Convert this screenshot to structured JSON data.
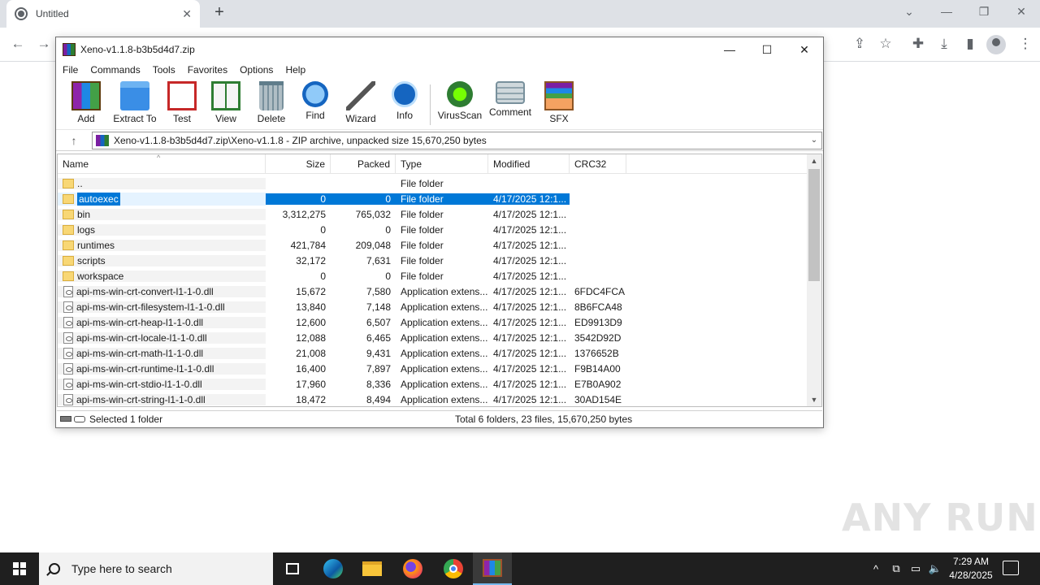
{
  "browser": {
    "tab_title": "Untitled",
    "new_tab": "+",
    "close_tab": "✕"
  },
  "winrar": {
    "title": "Xeno-v1.1.8-b3b5d4d7.zip",
    "menu": [
      "File",
      "Commands",
      "Tools",
      "Favorites",
      "Options",
      "Help"
    ],
    "toolbar": [
      {
        "label": "Add",
        "icon": "add-archive-icon"
      },
      {
        "label": "Extract To",
        "icon": "extract-folder-icon"
      },
      {
        "label": "Test",
        "icon": "test-clipboard-icon"
      },
      {
        "label": "View",
        "icon": "view-book-icon"
      },
      {
        "label": "Delete",
        "icon": "trash-icon"
      },
      {
        "label": "Find",
        "icon": "magnifier-icon"
      },
      {
        "label": "Wizard",
        "icon": "wand-icon"
      },
      {
        "label": "Info",
        "icon": "info-icon"
      },
      {
        "label": "VirusScan",
        "icon": "virus-scan-icon"
      },
      {
        "label": "Comment",
        "icon": "comment-icon"
      },
      {
        "label": "SFX",
        "icon": "sfx-box-icon"
      }
    ],
    "path": "Xeno-v1.1.8-b3b5d4d7.zip\\Xeno-v1.1.8 - ZIP archive, unpacked size 15,670,250 bytes",
    "columns": {
      "name": "Name",
      "size": "Size",
      "packed": "Packed",
      "type": "Type",
      "modified": "Modified",
      "crc": "CRC32"
    },
    "rows": [
      {
        "name": "..",
        "size": "",
        "packed": "",
        "type": "File folder",
        "modified": "",
        "crc": "",
        "kind": "folder"
      },
      {
        "name": "autoexec",
        "size": "0",
        "packed": "0",
        "type": "File folder",
        "modified": "4/17/2025 12:1...",
        "crc": "",
        "kind": "folder",
        "selected": true
      },
      {
        "name": "bin",
        "size": "3,312,275",
        "packed": "765,032",
        "type": "File folder",
        "modified": "4/17/2025 12:1...",
        "crc": "",
        "kind": "folder"
      },
      {
        "name": "logs",
        "size": "0",
        "packed": "0",
        "type": "File folder",
        "modified": "4/17/2025 12:1...",
        "crc": "",
        "kind": "folder"
      },
      {
        "name": "runtimes",
        "size": "421,784",
        "packed": "209,048",
        "type": "File folder",
        "modified": "4/17/2025 12:1...",
        "crc": "",
        "kind": "folder"
      },
      {
        "name": "scripts",
        "size": "32,172",
        "packed": "7,631",
        "type": "File folder",
        "modified": "4/17/2025 12:1...",
        "crc": "",
        "kind": "folder"
      },
      {
        "name": "workspace",
        "size": "0",
        "packed": "0",
        "type": "File folder",
        "modified": "4/17/2025 12:1...",
        "crc": "",
        "kind": "folder"
      },
      {
        "name": "api-ms-win-crt-convert-l1-1-0.dll",
        "size": "15,672",
        "packed": "7,580",
        "type": "Application extens...",
        "modified": "4/17/2025 12:1...",
        "crc": "6FDC4FCA",
        "kind": "dll"
      },
      {
        "name": "api-ms-win-crt-filesystem-l1-1-0.dll",
        "size": "13,840",
        "packed": "7,148",
        "type": "Application extens...",
        "modified": "4/17/2025 12:1...",
        "crc": "8B6FCA48",
        "kind": "dll"
      },
      {
        "name": "api-ms-win-crt-heap-l1-1-0.dll",
        "size": "12,600",
        "packed": "6,507",
        "type": "Application extens...",
        "modified": "4/17/2025 12:1...",
        "crc": "ED9913D9",
        "kind": "dll"
      },
      {
        "name": "api-ms-win-crt-locale-l1-1-0.dll",
        "size": "12,088",
        "packed": "6,465",
        "type": "Application extens...",
        "modified": "4/17/2025 12:1...",
        "crc": "3542D92D",
        "kind": "dll"
      },
      {
        "name": "api-ms-win-crt-math-l1-1-0.dll",
        "size": "21,008",
        "packed": "9,431",
        "type": "Application extens...",
        "modified": "4/17/2025 12:1...",
        "crc": "1376652B",
        "kind": "dll"
      },
      {
        "name": "api-ms-win-crt-runtime-l1-1-0.dll",
        "size": "16,400",
        "packed": "7,897",
        "type": "Application extens...",
        "modified": "4/17/2025 12:1...",
        "crc": "F9B14A00",
        "kind": "dll"
      },
      {
        "name": "api-ms-win-crt-stdio-l1-1-0.dll",
        "size": "17,960",
        "packed": "8,336",
        "type": "Application extens...",
        "modified": "4/17/2025 12:1...",
        "crc": "E7B0A902",
        "kind": "dll"
      },
      {
        "name": "api-ms-win-crt-string-l1-1-0.dll",
        "size": "18,472",
        "packed": "8,494",
        "type": "Application extens...",
        "modified": "4/17/2025 12:1...",
        "crc": "30AD154E",
        "kind": "dll"
      }
    ],
    "status_left": "Selected 1 folder",
    "status_right": "Total 6 folders, 23 files, 15,670,250 bytes"
  },
  "watermark": "ANY RUN",
  "taskbar": {
    "search_placeholder": "Type here to search",
    "time": "7:29 AM",
    "date": "4/28/2025"
  }
}
